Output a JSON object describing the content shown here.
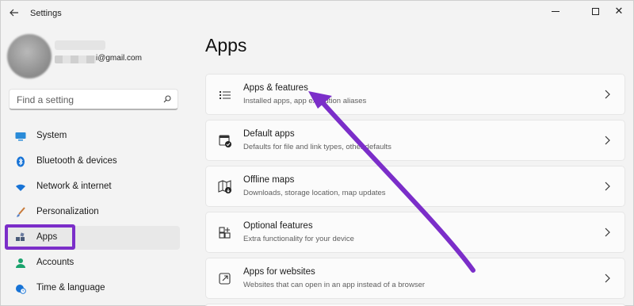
{
  "window": {
    "title": "Settings",
    "back_icon": "back-arrow-icon"
  },
  "profile": {
    "email_suffix": "i@gmail.com"
  },
  "search": {
    "placeholder": "Find a setting"
  },
  "sidebar": {
    "items": [
      {
        "label": "System",
        "icon": "monitor-icon",
        "color": "#0f6cbd"
      },
      {
        "label": "Bluetooth & devices",
        "icon": "bluetooth-icon",
        "color": "#0f6cbd"
      },
      {
        "label": "Network & internet",
        "icon": "wifi-icon",
        "color": "#0f6cbd"
      },
      {
        "label": "Personalization",
        "icon": "brush-icon",
        "color": "#c87a3a"
      },
      {
        "label": "Apps",
        "icon": "apps-icon",
        "color": "#4a5b7a",
        "selected": true
      },
      {
        "label": "Accounts",
        "icon": "person-icon",
        "color": "#1aa36d"
      },
      {
        "label": "Time & language",
        "icon": "globe-clock-icon",
        "color": "#0f6cbd"
      }
    ]
  },
  "main": {
    "title": "Apps",
    "cards": [
      {
        "title": "Apps & features",
        "subtitle": "Installed apps, app execution aliases",
        "icon": "list-icon"
      },
      {
        "title": "Default apps",
        "subtitle": "Defaults for file and link types, other defaults",
        "icon": "default-app-icon"
      },
      {
        "title": "Offline maps",
        "subtitle": "Downloads, storage location, map updates",
        "icon": "map-icon"
      },
      {
        "title": "Optional features",
        "subtitle": "Extra functionality for your device",
        "icon": "add-grid-icon"
      },
      {
        "title": "Apps for websites",
        "subtitle": "Websites that can open in an app instead of a browser",
        "icon": "open-external-icon"
      }
    ]
  },
  "colors": {
    "annotation": "#7b2ec9",
    "accent": "#0f6cbd"
  }
}
